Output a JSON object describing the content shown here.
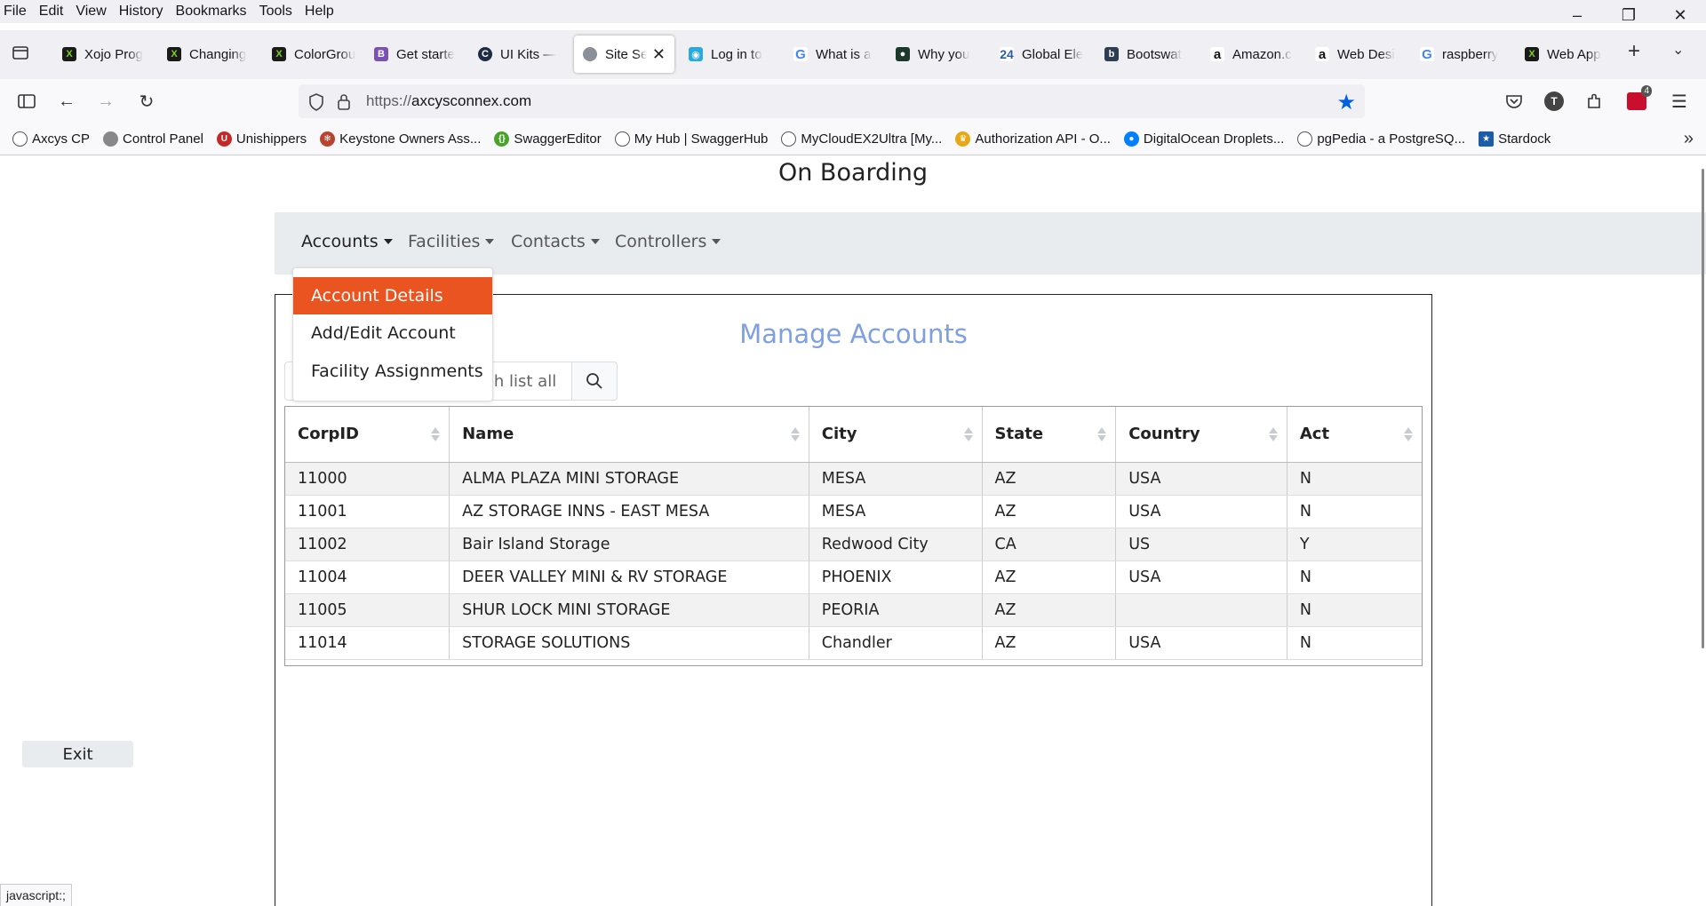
{
  "menubar": {
    "items": [
      "File",
      "Edit",
      "View",
      "History",
      "Bookmarks",
      "Tools",
      "Help"
    ]
  },
  "tabs": [
    {
      "label": "Xojo Prog",
      "icon": "xojo-icon"
    },
    {
      "label": "Changing",
      "icon": "xojo-icon"
    },
    {
      "label": "ColorGrou",
      "icon": "xojo-icon"
    },
    {
      "label": "Get starte",
      "icon": "bootstrap-icon"
    },
    {
      "label": "UI Kits —",
      "icon": "uikits-icon"
    },
    {
      "label": "Site Se",
      "icon": "globe-icon",
      "active": true
    },
    {
      "label": "Log in to",
      "icon": "login-icon"
    },
    {
      "label": "What is a",
      "icon": "google-icon"
    },
    {
      "label": "Why you",
      "icon": "site-icon"
    },
    {
      "label": "Global Ele",
      "icon": "24-icon"
    },
    {
      "label": "Bootswat",
      "icon": "bootswatch-icon"
    },
    {
      "label": "Amazon.c",
      "icon": "amazon-icon"
    },
    {
      "label": "Web Desi",
      "icon": "amazon-icon"
    },
    {
      "label": "raspberry",
      "icon": "google-icon"
    },
    {
      "label": "Web App",
      "icon": "xojo-icon"
    }
  ],
  "address": {
    "scheme": "https://",
    "host": "axcysconnex.com"
  },
  "toolbar": {
    "extensions_badge": "4"
  },
  "bookmarks": [
    {
      "label": "Axcys CP",
      "icon": "globe-icon"
    },
    {
      "label": "Control Panel",
      "icon": "globe-icon"
    },
    {
      "label": "Unishippers",
      "icon": "unishippers-icon"
    },
    {
      "label": "Keystone Owners Ass...",
      "icon": "keystone-icon"
    },
    {
      "label": "SwaggerEditor",
      "icon": "swagger-icon"
    },
    {
      "label": "My Hub | SwaggerHub",
      "icon": "globe-icon"
    },
    {
      "label": "MyCloudEX2Ultra [My...",
      "icon": "globe-icon"
    },
    {
      "label": "Authorization API - O...",
      "icon": "auth-icon"
    },
    {
      "label": "DigitalOcean Droplets...",
      "icon": "digitalocean-icon"
    },
    {
      "label": "pgPedia - a PostgreSQ...",
      "icon": "globe-icon"
    },
    {
      "label": "Stardock",
      "icon": "stardock-icon"
    }
  ],
  "page": {
    "title": "On Boarding",
    "nav": [
      {
        "label": "Accounts",
        "active": true
      },
      {
        "label": "Facilities"
      },
      {
        "label": "Contacts"
      },
      {
        "label": "Controllers"
      }
    ],
    "dropdown": [
      "Account Details",
      "Add/Edit Account",
      "Facility Assignments"
    ],
    "panel_title": "Manage Accounts",
    "search_placeholder": "Search list all",
    "visible_search_text": "ch list all",
    "exit_label": "Exit",
    "status_text": "javascript:;"
  },
  "table": {
    "headers": [
      "CorpID",
      "Name",
      "City",
      "State",
      "Country",
      "Act"
    ],
    "rows": [
      [
        "11000",
        "ALMA PLAZA MINI STORAGE",
        "MESA",
        "AZ",
        "USA",
        "N"
      ],
      [
        "11001",
        "AZ STORAGE INNS - EAST MESA",
        "MESA",
        "AZ",
        "USA",
        "N"
      ],
      [
        "11002",
        "Bair Island Storage",
        "Redwood City",
        "CA",
        "US",
        "Y"
      ],
      [
        "11004",
        "DEER VALLEY MINI & RV STORAGE",
        "PHOENIX",
        "AZ",
        "USA",
        "N"
      ],
      [
        "11005",
        "SHUR LOCK MINI STORAGE",
        "PEORIA",
        "AZ",
        "",
        "N"
      ],
      [
        "11014",
        "STORAGE SOLUTIONS",
        "Chandler",
        "AZ",
        "USA",
        "N"
      ]
    ]
  },
  "colors": {
    "accent": "#e95420",
    "panel_title": "#7fa0e0",
    "nav_bg": "#e9ecef",
    "bookmark_star": "#0061e0"
  }
}
